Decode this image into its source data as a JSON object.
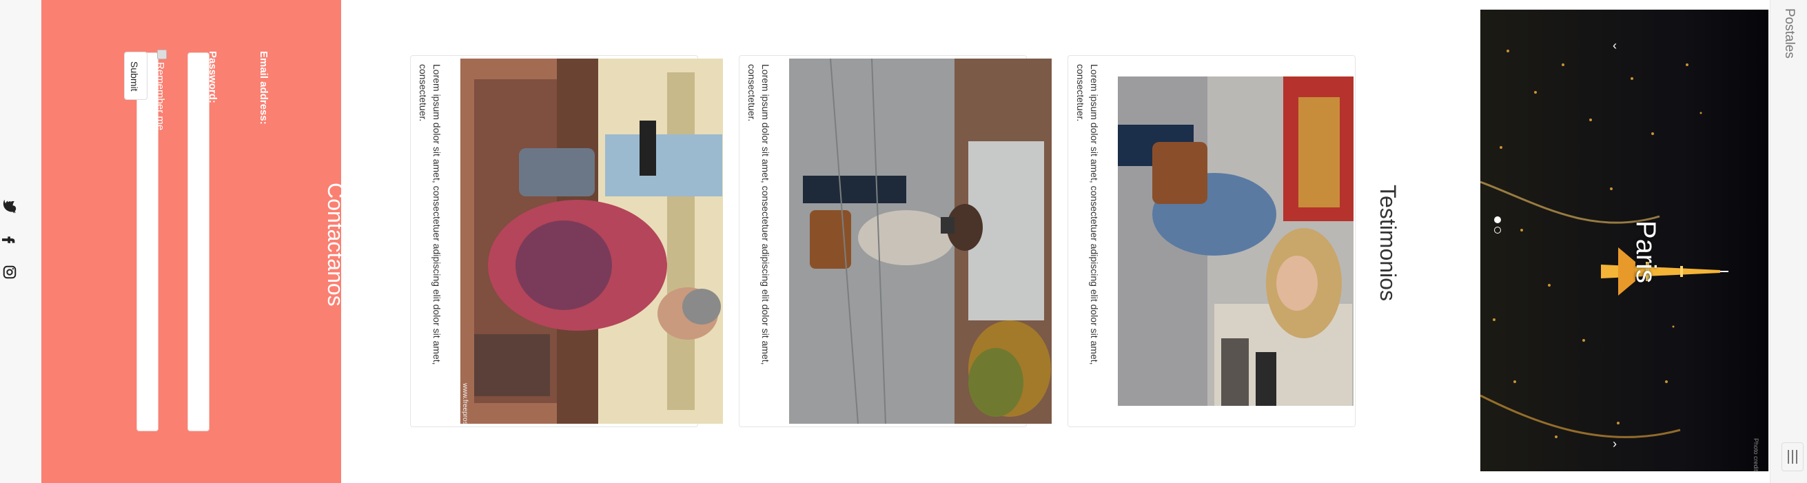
{
  "brand": "Postales",
  "hero": {
    "caption": "Paris",
    "credit": "Photo credit",
    "indicators_count": 2,
    "active_indicator": 2
  },
  "testimonials": {
    "title": "Testimonios",
    "cards": [
      {
        "text": "Lorem ipsum dolor sit amet, consectetuer adipiscing elit dolor sit amet, consectetuer."
      },
      {
        "text": "Lorem ipsum dolor sit amet, consectetuer adipiscing elit dolor sit amet, consectetuer."
      },
      {
        "text": "Lorem ipsum dolor sit amet, consectetuer adipiscing elit dolor sit amet, consectetuer.",
        "watermark": "www.freeprosee.com"
      }
    ]
  },
  "contact": {
    "title": "Contáctanos",
    "email_label": "Email address:",
    "password_label": "Password:",
    "remember_label": "Remember me",
    "submit_label": "Submit"
  },
  "social": [
    "twitter-icon",
    "facebook-icon",
    "instagram-icon"
  ],
  "colors": {
    "contact_bg": "#fa8072",
    "page_bg": "#ffffff",
    "nav_bg": "#f5f5f5"
  }
}
